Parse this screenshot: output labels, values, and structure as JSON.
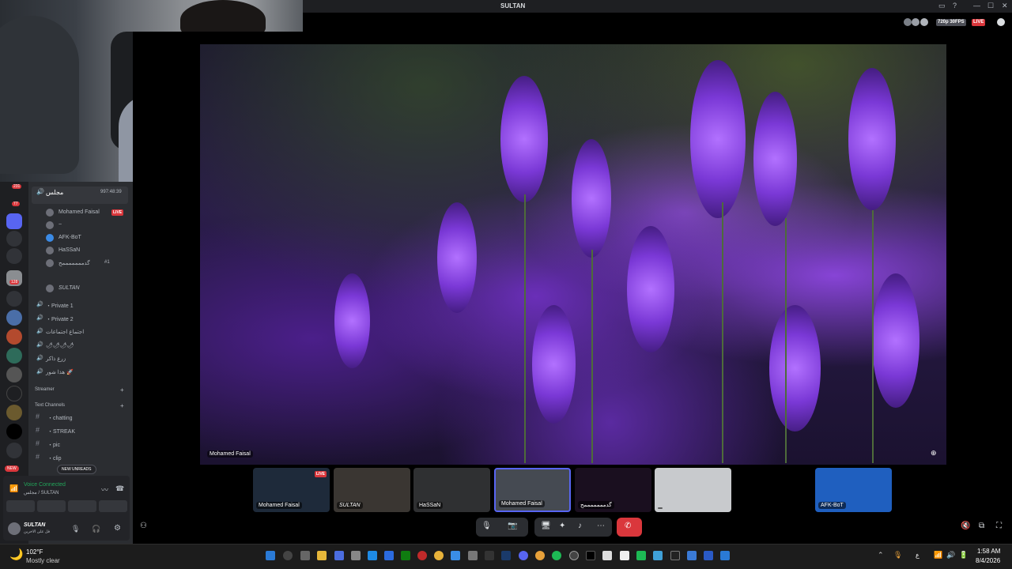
{
  "window": {
    "title": "SULTAN",
    "minimize": "—",
    "maximize": "☐",
    "close": "✕"
  },
  "stream": {
    "quality": "720p 30FPS",
    "live": "LIVE",
    "streamer_label": "Mohamed Faisal"
  },
  "sidebar": {
    "badges": [
      "231",
      "77",
      "128",
      "NEW"
    ],
    "voice_channel": {
      "name": "مجلس",
      "timer": "997:48:39"
    },
    "voice_users": [
      {
        "name": "Mohamed Faisal",
        "live": "LIVE"
      },
      {
        "name": "~"
      },
      {
        "name": "AFK-BoT"
      },
      {
        "name": "HaSSaN"
      },
      {
        "name": "گدمممممممح",
        "tag": "#1"
      }
    ],
    "user2": "SULTAN",
    "channels": [
      {
        "name": "・Private 1"
      },
      {
        "name": "・Private 2"
      },
      {
        "name": "اجتماع اجتماعات"
      },
      {
        "name": "🌶🌶🌶🌶"
      },
      {
        "name": "زرع ذاكر"
      },
      {
        "name": "هذا شور 🚀"
      }
    ],
    "categories": {
      "streamer": "Streamer",
      "text": "Text Channels"
    },
    "text_channels": [
      "・chatting",
      "・STREAK",
      "・pic",
      "・clip"
    ],
    "new_unreads": "NEW UNREADS"
  },
  "voice_panel": {
    "status": "Voice Connected",
    "location": "مجلس / SULTAN"
  },
  "user_panel": {
    "name": "SULTAN",
    "status": "فل على الاخرين"
  },
  "tiles": [
    {
      "name": "Mohamed Faisal",
      "live": "LIVE"
    },
    {
      "name": "SULTAN"
    },
    {
      "name": "HaSSaN"
    },
    {
      "name": "Mohamed Faisal"
    },
    {
      "name": "گدمممممممح"
    },
    {
      "name": ""
    },
    {
      "name": "AFK-BoT"
    }
  ],
  "taskbar": {
    "weather_temp": "102°F",
    "weather_desc": "Mostly clear",
    "time": "1:58 AM",
    "date": "8/4/2026",
    "lang": "ع"
  },
  "colors": {
    "accent": "#5865f2",
    "live": "#da373c",
    "voice_green": "#23a55a",
    "bg": "#2b2d31"
  }
}
